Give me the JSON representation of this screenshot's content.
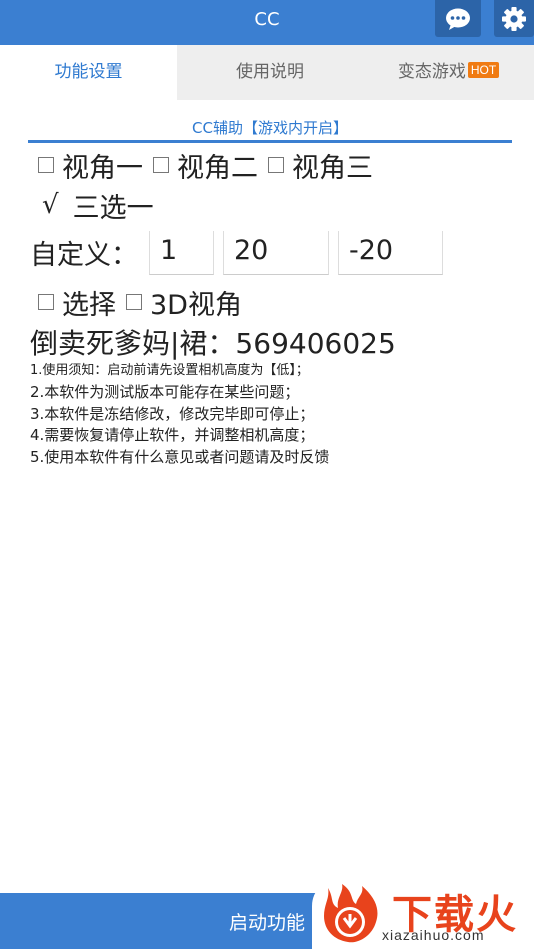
{
  "header": {
    "title": "CC",
    "chat_icon": "chat-bubble-icon",
    "settings_icon": "gear-icon"
  },
  "tabs": [
    {
      "label": "功能设置",
      "active": true
    },
    {
      "label": "使用说明",
      "active": false
    },
    {
      "label": "变态游戏",
      "badge": "HOT",
      "active": false
    }
  ],
  "section": {
    "title": "CC辅助【游戏内开启】"
  },
  "view_options": [
    {
      "label": "视角一",
      "checked": false
    },
    {
      "label": "视角二",
      "checked": false
    },
    {
      "label": "视角三",
      "checked": false
    }
  ],
  "choice": {
    "check_mark": "√",
    "label": "三选一"
  },
  "custom": {
    "label": "自定义：",
    "values": [
      "1",
      "20",
      "-20"
    ]
  },
  "extra_options": [
    {
      "label": "选择",
      "checked": false
    },
    {
      "label": "3D视角",
      "checked": false
    }
  ],
  "contact_line": "倒卖死爹妈|裙：569406025",
  "notes": [
    "1.使用须知：启动前请先设置相机高度为【低】；",
    "2.本软件为测试版本可能存在某些问题；",
    "3.本软件是冻结修改，修改完毕即可停止；",
    "4.需要恢复请停止软件，并调整相机高度；",
    "5.使用本软件有什么意见或者问题请及时反馈"
  ],
  "footer": {
    "start_label": "启动功能"
  },
  "watermark": {
    "brand": "下载火",
    "domain": "xiazaihuo.com"
  },
  "colors": {
    "primary": "#3b7fd1",
    "hot": "#f07b12",
    "brand_red": "#e8431c"
  }
}
